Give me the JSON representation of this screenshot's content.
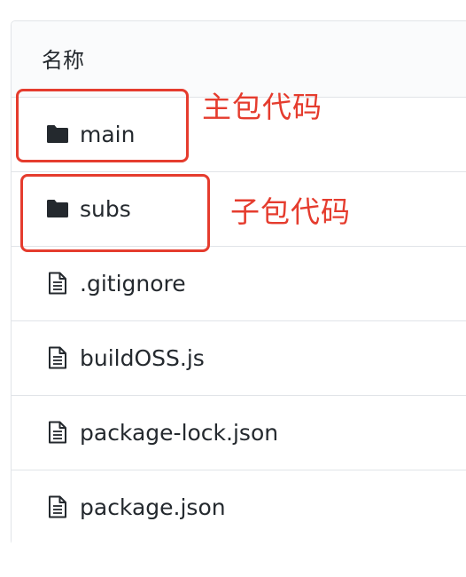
{
  "table": {
    "header_label": "名称",
    "rows": [
      {
        "name": "main",
        "icon": "folder-icon"
      },
      {
        "name": "subs",
        "icon": "folder-icon"
      },
      {
        "name": ".gitignore",
        "icon": "file-icon"
      },
      {
        "name": "buildOSS.js",
        "icon": "file-icon"
      },
      {
        "name": "package-lock.json",
        "icon": "file-icon"
      },
      {
        "name": "package.json",
        "icon": "file-icon"
      }
    ]
  },
  "annotations": {
    "main_note": "主包代码",
    "subs_note": "子包代码",
    "color": "#e53c2e"
  },
  "colors": {
    "text": "#24292e",
    "border": "#e1e4e8",
    "header_bg": "#fafbfc"
  }
}
